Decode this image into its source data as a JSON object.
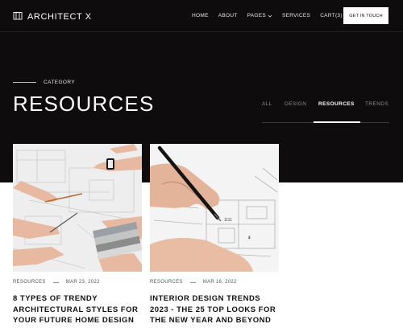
{
  "brand": {
    "name": "ARCHITECT X",
    "icon": "building-icon"
  },
  "nav": {
    "items": [
      {
        "label": "HOME"
      },
      {
        "label": "ABOUT"
      },
      {
        "label": "PAGES",
        "has_dropdown": true
      },
      {
        "label": "SERVICES"
      },
      {
        "label": "CART(3)"
      }
    ],
    "cta_label": "GET IN TOUCH"
  },
  "hero": {
    "eyebrow": "CATEGORY",
    "title": "RESOURCES",
    "filters": [
      {
        "label": "ALL",
        "active": false
      },
      {
        "label": "DESIGN",
        "active": false
      },
      {
        "label": "RESOURCES",
        "active": true
      },
      {
        "label": "TRENDS",
        "active": false
      }
    ]
  },
  "posts": [
    {
      "category": "RESOURCES",
      "date": "MAR 23, 2022",
      "title": "8 TYPES OF TRENDY ARCHITECTURAL STYLES FOR YOUR FUTURE HOME DESIGN",
      "image": "hands-reviewing-blueprints-photo"
    },
    {
      "category": "RESOURCES",
      "date": "MAR 16, 2022",
      "title": "INTERIOR DESIGN TRENDS 2023 - THE 25 TOP LOOKS FOR THE NEW YEAR AND BEYOND",
      "image": "hand-drawing-floor-plan-photo"
    }
  ],
  "colors": {
    "hero_bg": "#0e0c0d",
    "text_light": "#ffffff",
    "text_muted": "#8d8d8d"
  }
}
